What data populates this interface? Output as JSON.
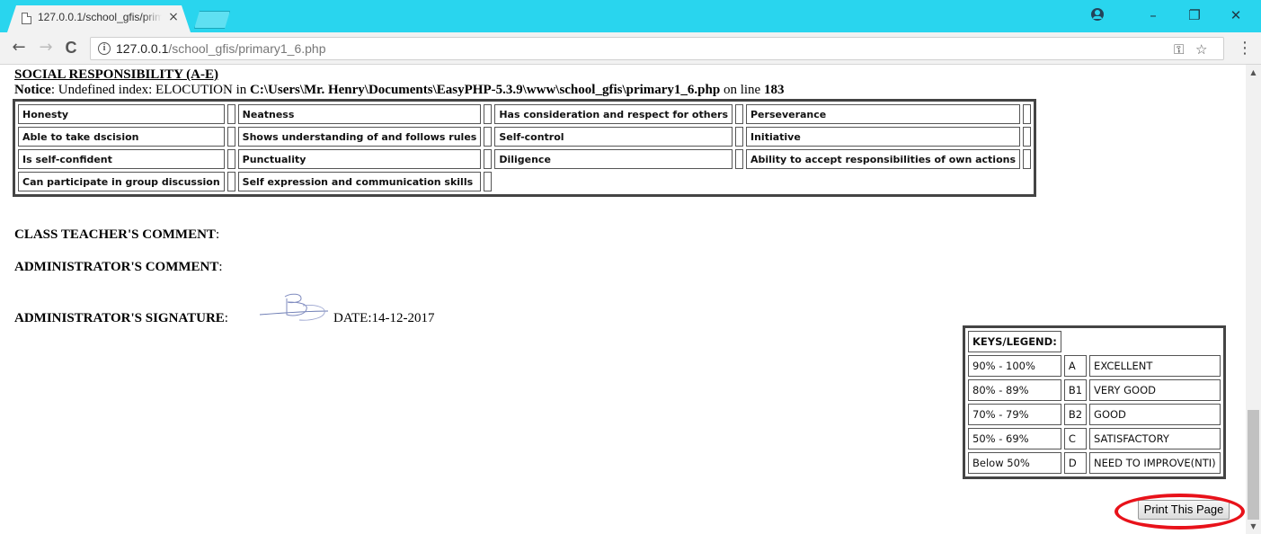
{
  "browser": {
    "tab_title": "127.0.0.1/school_gfis/primary1_6.php",
    "tab_close": "×",
    "url_host": "127.0.0.1",
    "url_path": "/school_gfis/primary1_6.php",
    "window_controls": {
      "minimize": "–",
      "restore": "❐",
      "close": "✕"
    },
    "nav": {
      "back": "←",
      "forward": "→",
      "reload": "C"
    },
    "menu_glyph": "⋮",
    "key_glyph": "⚿",
    "star_glyph": "☆"
  },
  "page": {
    "section_title": "SOCIAL RESPONSIBILITY (A-E)",
    "notice": {
      "label": "Notice",
      "message": ": Undefined index: ELOCUTION in ",
      "path": "C:\\Users\\Mr. Henry\\Documents\\EasyPHP-5.3.9\\www\\school_gfis\\primary1_6.php",
      "suffix": " on line ",
      "line": "183"
    },
    "traits": [
      [
        "Honesty",
        "Neatness",
        "Has consideration and respect for others",
        "Perseverance"
      ],
      [
        "Able to take dscision",
        "Shows understanding of and follows rules",
        "Self-control",
        "Initiative"
      ],
      [
        "Is self-confident",
        "Punctuality",
        "Diligence",
        "Ability to accept responsibilities of own actions"
      ],
      [
        "Can participate in group discussion",
        "Self expression and communication skills"
      ]
    ],
    "class_teacher_comment_label": "CLASS TEACHER'S COMMENT",
    "administrator_comment_label": "ADMINISTRATOR'S COMMENT",
    "administrator_signature_label": "ADMINISTRATOR'S SIGNATURE",
    "colon": ":",
    "date_text": "DATE:14-12-2017",
    "legend": {
      "heading": "KEYS/LEGEND:",
      "rows": [
        {
          "range": "90% - 100%",
          "grade": "A",
          "remark": "EXCELLENT"
        },
        {
          "range": "80% - 89%",
          "grade": "B1",
          "remark": "VERY GOOD"
        },
        {
          "range": "70% - 79%",
          "grade": "B2",
          "remark": "GOOD"
        },
        {
          "range": "50% - 69%",
          "grade": "C",
          "remark": "SATISFACTORY"
        },
        {
          "range": "Below 50%",
          "grade": "D",
          "remark": "NEED TO IMPROVE(NTI)"
        }
      ]
    },
    "print_button_label": "Print This Page"
  },
  "colors": {
    "title_bar": "#29d5ee",
    "highlight_circle": "#e8121a"
  }
}
